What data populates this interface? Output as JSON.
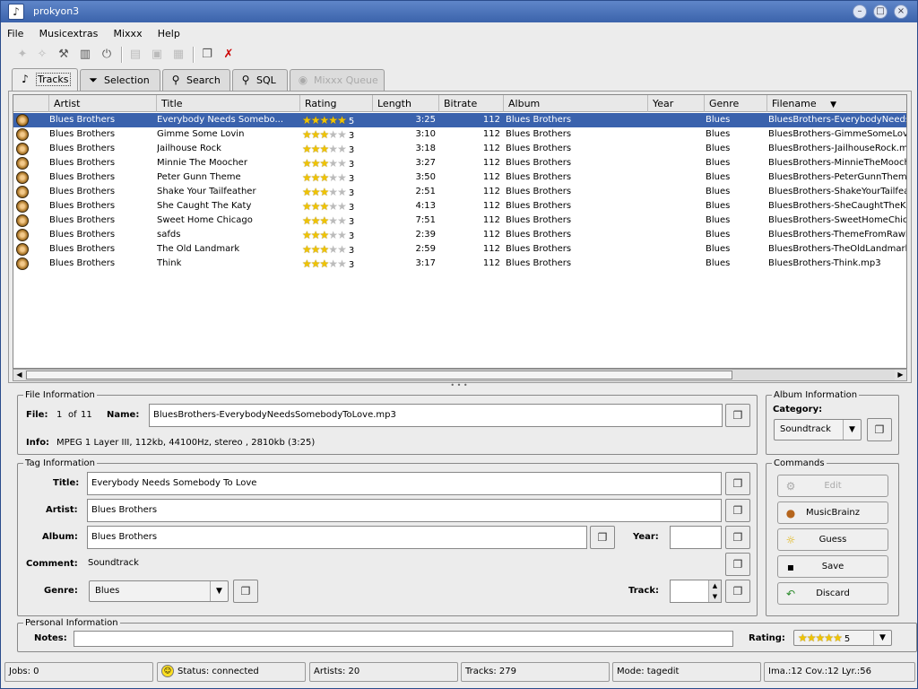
{
  "window": {
    "title": "prokyon3"
  },
  "menu": [
    "File",
    "Musicextras",
    "Mixxx",
    "Help"
  ],
  "tabs": [
    {
      "label": "Tracks",
      "icon": "music-note-icon"
    },
    {
      "label": "Selection",
      "icon": "funnel-icon"
    },
    {
      "label": "Search",
      "icon": "magnifier-icon"
    },
    {
      "label": "SQL",
      "icon": "sql-magnifier-icon"
    },
    {
      "label": "Mixxx Queue",
      "icon": "mixxx-icon"
    }
  ],
  "table": {
    "columns": [
      "Artist",
      "Title",
      "Rating",
      "Length",
      "Bitrate",
      "Album",
      "Year",
      "Genre",
      "Filename"
    ],
    "rows": [
      {
        "artist": "Blues Brothers",
        "title": "Everybody Needs Somebo...",
        "rating": 5,
        "length": "3:25",
        "bitrate": "112",
        "album": "Blues Brothers",
        "year": "",
        "genre": "Blues",
        "filename": "BluesBrothers-EverybodyNeeds"
      },
      {
        "artist": "Blues Brothers",
        "title": "Gimme Some Lovin",
        "rating": 3,
        "length": "3:10",
        "bitrate": "112",
        "album": "Blues Brothers",
        "year": "",
        "genre": "Blues",
        "filename": "BluesBrothers-GimmeSomeLov"
      },
      {
        "artist": "Blues Brothers",
        "title": "Jailhouse Rock",
        "rating": 3,
        "length": "3:18",
        "bitrate": "112",
        "album": "Blues Brothers",
        "year": "",
        "genre": "Blues",
        "filename": "BluesBrothers-JailhouseRock.mp"
      },
      {
        "artist": "Blues Brothers",
        "title": "Minnie The Moocher",
        "rating": 3,
        "length": "3:27",
        "bitrate": "112",
        "album": "Blues Brothers",
        "year": "",
        "genre": "Blues",
        "filename": "BluesBrothers-MinnieTheMooche"
      },
      {
        "artist": "Blues Brothers",
        "title": "Peter Gunn Theme",
        "rating": 3,
        "length": "3:50",
        "bitrate": "112",
        "album": "Blues Brothers",
        "year": "",
        "genre": "Blues",
        "filename": "BluesBrothers-PeterGunnTheme"
      },
      {
        "artist": "Blues Brothers",
        "title": "Shake Your Tailfeather",
        "rating": 3,
        "length": "2:51",
        "bitrate": "112",
        "album": "Blues Brothers",
        "year": "",
        "genre": "Blues",
        "filename": "BluesBrothers-ShakeYourTailfea"
      },
      {
        "artist": "Blues Brothers",
        "title": "She Caught The Katy",
        "rating": 3,
        "length": "4:13",
        "bitrate": "112",
        "album": "Blues Brothers",
        "year": "",
        "genre": "Blues",
        "filename": "BluesBrothers-SheCaughtTheKa"
      },
      {
        "artist": "Blues Brothers",
        "title": "Sweet Home Chicago",
        "rating": 3,
        "length": "7:51",
        "bitrate": "112",
        "album": "Blues Brothers",
        "year": "",
        "genre": "Blues",
        "filename": "BluesBrothers-SweetHomeChic"
      },
      {
        "artist": "Blues Brothers",
        "title": "safds",
        "rating": 3,
        "length": "2:39",
        "bitrate": "112",
        "album": "Blues Brothers",
        "year": "",
        "genre": "Blues",
        "filename": "BluesBrothers-ThemeFromRawl"
      },
      {
        "artist": "Blues Brothers",
        "title": "The Old Landmark",
        "rating": 3,
        "length": "2:59",
        "bitrate": "112",
        "album": "Blues Brothers",
        "year": "",
        "genre": "Blues",
        "filename": "BluesBrothers-TheOldLandmark"
      },
      {
        "artist": "Blues Brothers",
        "title": "Think",
        "rating": 3,
        "length": "3:17",
        "bitrate": "112",
        "album": "Blues Brothers",
        "year": "",
        "genre": "Blues",
        "filename": "BluesBrothers-Think.mp3"
      }
    ],
    "selected_row": 0
  },
  "file_info": {
    "legend": "File Information",
    "file_label": "File:",
    "file_index": "1",
    "file_of": "of",
    "file_total": "11",
    "name_label": "Name:",
    "name_value": "BluesBrothers-EverybodyNeedsSomebodyToLove.mp3",
    "info_label": "Info:",
    "info_value": "MPEG 1 Layer III, 112kb, 44100Hz, stereo , 2810kb (3:25)"
  },
  "album_info": {
    "legend": "Album Information",
    "category_label": "Category:",
    "category_value": "Soundtrack"
  },
  "tag_info": {
    "legend": "Tag Information",
    "title_label": "Title:",
    "title_value": "Everybody Needs Somebody To Love",
    "artist_label": "Artist:",
    "artist_value": "Blues Brothers",
    "album_label": "Album:",
    "album_value": "Blues Brothers",
    "year_label": "Year:",
    "year_value": "",
    "comment_label": "Comment:",
    "comment_value": "Soundtrack",
    "genre_label": "Genre:",
    "genre_value": "Blues",
    "track_label": "Track:",
    "track_value": ""
  },
  "commands": {
    "legend": "Commands",
    "edit": "Edit",
    "musicbrainz": "MusicBrainz",
    "guess": "Guess",
    "save": "Save",
    "discard": "Discard"
  },
  "personal": {
    "legend": "Personal Information",
    "notes_label": "Notes:",
    "notes_value": "",
    "rating_label": "Rating:",
    "rating_value": 5
  },
  "status": {
    "jobs": "Jobs: 0",
    "status": "Status: connected",
    "artists": "Artists: 20",
    "tracks": "Tracks: 279",
    "mode": "Mode: tagedit",
    "covers": "Ima.:12 Cov.:12 Lyr.:56"
  },
  "colors": {
    "selection": "#3a62ad",
    "titlebar": "#4a72b8",
    "star": "#f0c400"
  }
}
